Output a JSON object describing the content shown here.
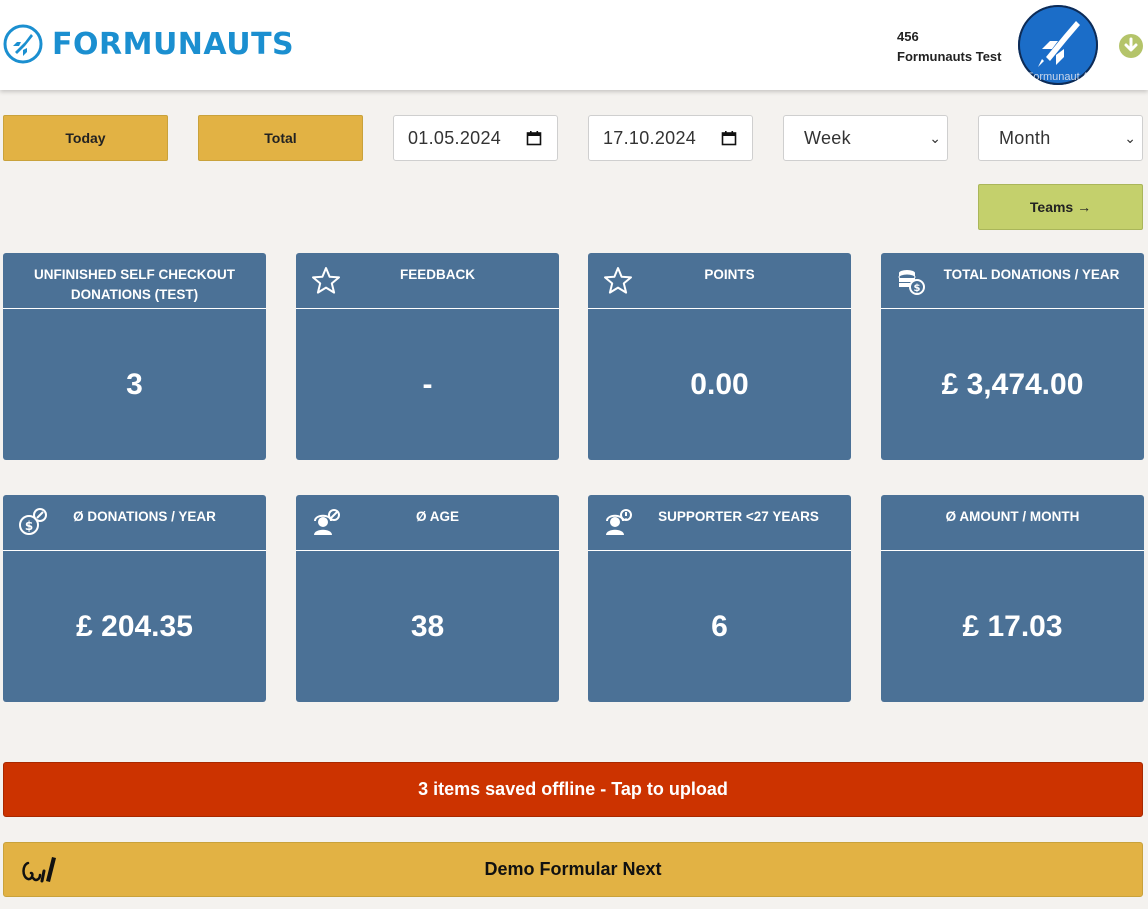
{
  "header": {
    "logo_text": "FORMUNAUTS",
    "user_id": "456",
    "user_name": "Formunauts Test",
    "avatar_caption": "Formunaut A"
  },
  "filters": {
    "today_label": "Today",
    "total_label": "Total",
    "date_from": "01.05.2024",
    "date_to": "17.10.2024",
    "period_select": "Week",
    "range_select": "Month",
    "teams_label": "Teams →"
  },
  "cards": [
    {
      "title": "UNFINISHED SELF CHECKOUT DONATIONS (TEST)",
      "value": "3",
      "icon": "none"
    },
    {
      "title": "FEEDBACK",
      "value": "-",
      "icon": "star-icon"
    },
    {
      "title": "POINTS",
      "value": "0.00",
      "icon": "star-icon"
    },
    {
      "title": "TOTAL DONATIONS / YEAR",
      "value": "£ 3,474.00",
      "icon": "coins-icon"
    },
    {
      "title": "Ø DONATIONS / YEAR",
      "value": "£ 204.35",
      "icon": "money-exchange-icon"
    },
    {
      "title": "Ø AGE",
      "value": "38",
      "icon": "user-age-icon"
    },
    {
      "title": "SUPPORTER <27 YEARS",
      "value": "6",
      "icon": "user-alert-icon"
    },
    {
      "title": "Ø AMOUNT / MONTH",
      "value": "£ 17.03",
      "icon": "none"
    }
  ],
  "upload_banner": "3 items saved offline - Tap to upload",
  "form_button": "Demo Formular Next",
  "colors": {
    "brand_blue": "#1b8fd0",
    "card_blue": "#4b7196",
    "yellow": "#e2b244",
    "green": "#c4d06c",
    "alert_red": "#cc3300"
  }
}
